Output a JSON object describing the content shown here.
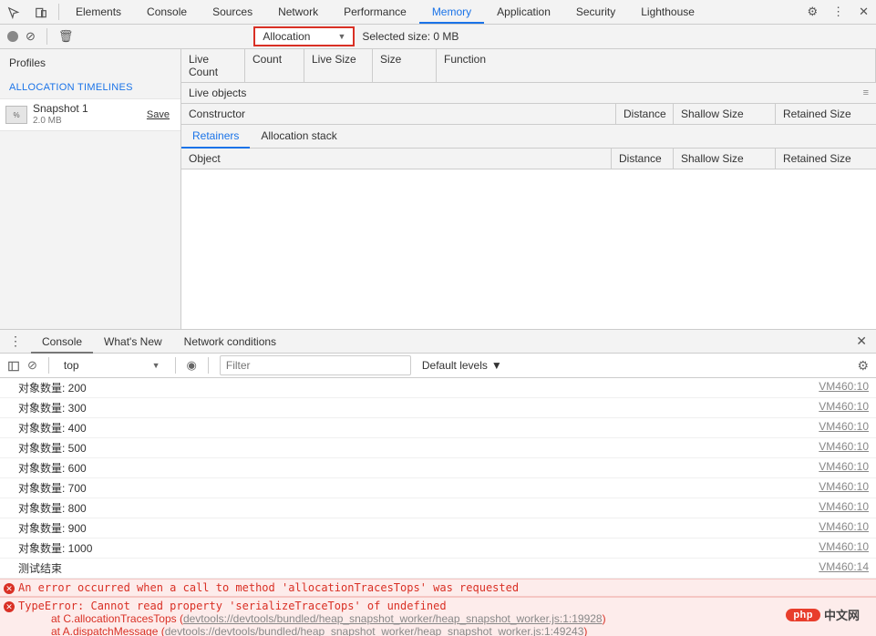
{
  "top_tabs": {
    "elements": "Elements",
    "console": "Console",
    "sources": "Sources",
    "network": "Network",
    "performance": "Performance",
    "memory": "Memory",
    "application": "Application",
    "security": "Security",
    "lighthouse": "Lighthouse"
  },
  "mem_toolbar": {
    "dropdown_label": "Allocation",
    "selected_size": "Selected size: 0 MB"
  },
  "sidebar": {
    "profiles": "Profiles",
    "section": "ALLOCATION TIMELINES",
    "snapshot": {
      "title": "Snapshot 1",
      "size": "2.0 MB",
      "save": "Save"
    }
  },
  "grid": {
    "live_count": "Live Count",
    "count": "Count",
    "live_size": "Live Size",
    "size": "Size",
    "function": "Function",
    "live_objects": "Live objects",
    "constructor": "Constructor",
    "distance": "Distance",
    "shallow": "Shallow Size",
    "retained": "Retained Size",
    "retainers": "Retainers",
    "alloc_stack": "Allocation stack",
    "object": "Object"
  },
  "drawer": {
    "console": "Console",
    "whats_new": "What's New",
    "net_cond": "Network conditions"
  },
  "console_toolbar": {
    "context": "top",
    "filter_placeholder": "Filter",
    "levels": "Default levels"
  },
  "console_logs": [
    {
      "msg": "对象数量: 200",
      "src": "VM460:10"
    },
    {
      "msg": "对象数量: 300",
      "src": "VM460:10"
    },
    {
      "msg": "对象数量: 400",
      "src": "VM460:10"
    },
    {
      "msg": "对象数量: 500",
      "src": "VM460:10"
    },
    {
      "msg": "对象数量: 600",
      "src": "VM460:10"
    },
    {
      "msg": "对象数量: 700",
      "src": "VM460:10"
    },
    {
      "msg": "对象数量: 800",
      "src": "VM460:10"
    },
    {
      "msg": "对象数量: 900",
      "src": "VM460:10"
    },
    {
      "msg": "对象数量: 1000",
      "src": "VM460:10"
    },
    {
      "msg": "测试结束",
      "src": "VM460:14"
    }
  ],
  "errors": {
    "err1": "An error occurred when a call to method 'allocationTracesTops' was requested",
    "err2": "TypeError: Cannot read property 'serializeTraceTops' of undefined",
    "stack1_prefix": "at C.allocationTracesTops (",
    "stack1_link": "devtools://devtools/bundled/heap_snapshot_worker/heap_snapshot_worker.js:1:19928",
    "stack1_suffix": ")",
    "stack2_prefix": "at A.dispatchMessage (",
    "stack2_link": "devtools://devtools/bundled/heap_snapshot_worker/heap_snapshot_worker.js:1:49243",
    "stack2_suffix": ")"
  },
  "logo": {
    "badge": "php",
    "text": "中文网"
  }
}
